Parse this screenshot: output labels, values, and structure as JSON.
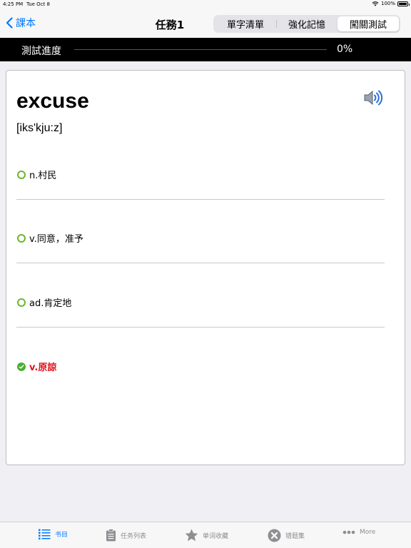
{
  "status_bar": {
    "time": "4:25 PM",
    "date": "Tue Oct 8",
    "battery": "100%"
  },
  "nav": {
    "back_label": "課本",
    "title": "任務1",
    "segments": [
      "單字清單",
      "強化記憶",
      "闖關測試"
    ],
    "active_segment": 2
  },
  "progress": {
    "label": "測試進度",
    "value_text": "0%",
    "fraction": 0
  },
  "card": {
    "word": "excuse",
    "phonetic": "[iks'kju:z]",
    "options": [
      {
        "text": "n.村民",
        "state": "unselected"
      },
      {
        "text": "v.同意，准予",
        "state": "unselected"
      },
      {
        "text": "ad.肯定地",
        "state": "unselected"
      },
      {
        "text": "v.原諒",
        "state": "correct"
      }
    ]
  },
  "tab_bar": {
    "items": [
      {
        "label": "书目",
        "icon": "list-icon",
        "active": true
      },
      {
        "label": "任务列表",
        "icon": "clipboard-icon",
        "active": false
      },
      {
        "label": "单词收藏",
        "icon": "star-icon",
        "active": false
      },
      {
        "label": "错题集",
        "icon": "x-circle-icon",
        "active": false
      },
      {
        "label": "More",
        "icon": "more-icon",
        "active": false
      }
    ]
  },
  "colors": {
    "accent": "#007aff",
    "correct": "#e0141e",
    "radio": "#6bb62d"
  }
}
